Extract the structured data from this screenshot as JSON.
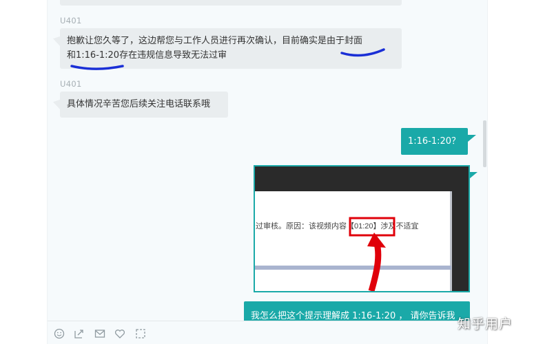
{
  "messages": [
    {
      "sender": "U401",
      "text_line1": "抱歉让您久等了，这边帮您与工作人员进行再次确认，目前确实是由于封面",
      "text_line2": "和1:16-1:20存在违规信息导致无法过审"
    },
    {
      "sender": "U401",
      "text": "具体情况辛苦您后续关注电话联系哦"
    }
  ],
  "user_messages": {
    "reply1": "1:16-1:20？",
    "reply2": "我怎么把这个提示理解成 1:16-1:20 ， 请你告诉我"
  },
  "screenshot_image": {
    "notice_text": "过审核。原因：该视频内容【01:20】涉及不适宜",
    "highlight_text": "【01:20】"
  },
  "toolbar": {
    "icons": [
      "emoji-icon",
      "upload-file-icon",
      "mail-icon",
      "heart-icon",
      "screenshot-icon"
    ]
  },
  "watermark": "知乎用户",
  "colors": {
    "accent": "#1aa9a8",
    "bubble_left": "#e9edef",
    "annotation_blue": "#1a2fd6",
    "annotation_red": "#e0000a"
  }
}
